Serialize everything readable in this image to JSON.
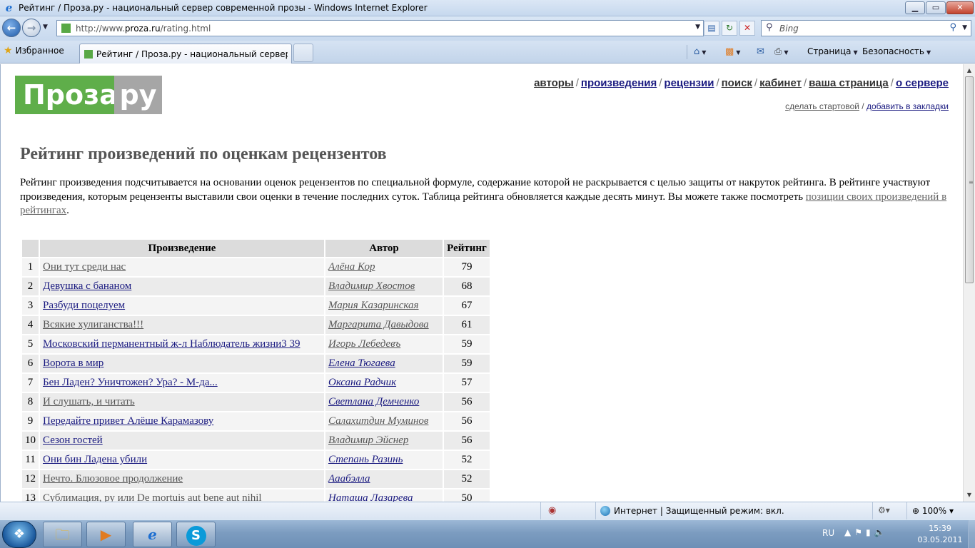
{
  "window": {
    "title": "Рейтинг / Проза.ру - национальный сервер современной прозы - Windows Internet Explorer",
    "minimize": "▁",
    "maximize": "▭",
    "close": "✕"
  },
  "address": {
    "url_prefix": "http://www.",
    "url_domain": "proza.ru",
    "url_path": "/rating.html",
    "search_placeholder": "Bing"
  },
  "tabs": {
    "favorites_label": "Избранное",
    "active_tab_title": "Рейтинг / Проза.ру - национальный сервер со...",
    "commands": {
      "page": "Страница",
      "safety": "Безопасность"
    }
  },
  "site": {
    "logo_left": "Проза",
    "logo_right": "ру",
    "nav": [
      {
        "label": "авторы",
        "style": "gray"
      },
      {
        "label": "произведения",
        "style": "blue"
      },
      {
        "label": "рецензии",
        "style": "blue"
      },
      {
        "label": "поиск",
        "style": "gray"
      },
      {
        "label": "кабинет",
        "style": "gray"
      },
      {
        "label": "ваша страница",
        "style": "gray"
      },
      {
        "label": "о сервере",
        "style": "blue"
      }
    ],
    "subnav": {
      "make_home": "сделать стартовой",
      "bookmark": "добавить в закладки"
    }
  },
  "page": {
    "heading": "Рейтинг произведений по оценкам рецензентов",
    "intro_text": "Рейтинг произведения подсчитывается на основании оценок рецензентов по специальной формуле, содержание которой не раскрывается с целью защиты от накруток рейтинга. В рейтинге участвуют произведения, которым рецензенты выставили свои оценки в течение последних суток. Таблица рейтинга обновляется каждые десять минут. Вы можете также посмотреть ",
    "intro_link": "позиции своих произведений в рейтингах",
    "intro_end": "."
  },
  "table": {
    "headers": {
      "num": "",
      "work": "Произведение",
      "author": "Автор",
      "rating": "Рейтинг"
    },
    "rows": [
      {
        "num": "1",
        "work": "Они тут среди нас",
        "work_style": "v",
        "author": "Алёна Кор",
        "author_style": "v",
        "rating": "79"
      },
      {
        "num": "2",
        "work": "Девушка с бананом",
        "work_style": "u",
        "author": "Владимир Хвостов",
        "author_style": "v",
        "rating": "68"
      },
      {
        "num": "3",
        "work": "Разбуди поцелуем",
        "work_style": "u",
        "author": "Мария Казаринская",
        "author_style": "v",
        "rating": "67"
      },
      {
        "num": "4",
        "work": "Всякие хулиганства!!!",
        "work_style": "v",
        "author": "Маргарита Давыдова",
        "author_style": "v",
        "rating": "61"
      },
      {
        "num": "5",
        "work": "Московский перманентный ж-л Наблюдатель жизни3 39",
        "work_style": "u",
        "author": "Игорь Лебедевъ",
        "author_style": "v",
        "rating": "59"
      },
      {
        "num": "6",
        "work": "Ворота в мир",
        "work_style": "u",
        "author": "Елена Тюгаева",
        "author_style": "u",
        "rating": "59"
      },
      {
        "num": "7",
        "work": "Бен Ладен? Уничтожен? Ура? - М-да...",
        "work_style": "u",
        "author": "Оксана Радчик",
        "author_style": "u",
        "rating": "57"
      },
      {
        "num": "8",
        "work": "И слушать, и читать",
        "work_style": "v",
        "author": "Светлана Демченко",
        "author_style": "u",
        "rating": "56"
      },
      {
        "num": "9",
        "work": "Передайте привет Алёше Карамазову",
        "work_style": "u",
        "author": "Салахитдин Муминов",
        "author_style": "v",
        "rating": "56"
      },
      {
        "num": "10",
        "work": "Сезон гостей",
        "work_style": "u",
        "author": "Владимир Эйснер",
        "author_style": "v",
        "rating": "56"
      },
      {
        "num": "11",
        "work": "Они бин Ладена убили",
        "work_style": "u",
        "author": "Степань Разинь",
        "author_style": "u",
        "rating": "52"
      },
      {
        "num": "12",
        "work": "Нечто. Блюзовое продолжение",
        "work_style": "v",
        "author": "Аaaбэлла",
        "author_style": "u",
        "rating": "52"
      },
      {
        "num": "13",
        "work": "Сублимация, ру или De mortuis aut bene aut nihil",
        "work_style": "v",
        "author": "Наташа Лазарева",
        "author_style": "u",
        "rating": "50"
      }
    ]
  },
  "statusbar": {
    "zone": "Интернет | Защищенный режим: вкл.",
    "zoom": "100%"
  },
  "taskbar": {
    "lang": "RU",
    "time": "15:39",
    "date": "03.05.2011"
  }
}
